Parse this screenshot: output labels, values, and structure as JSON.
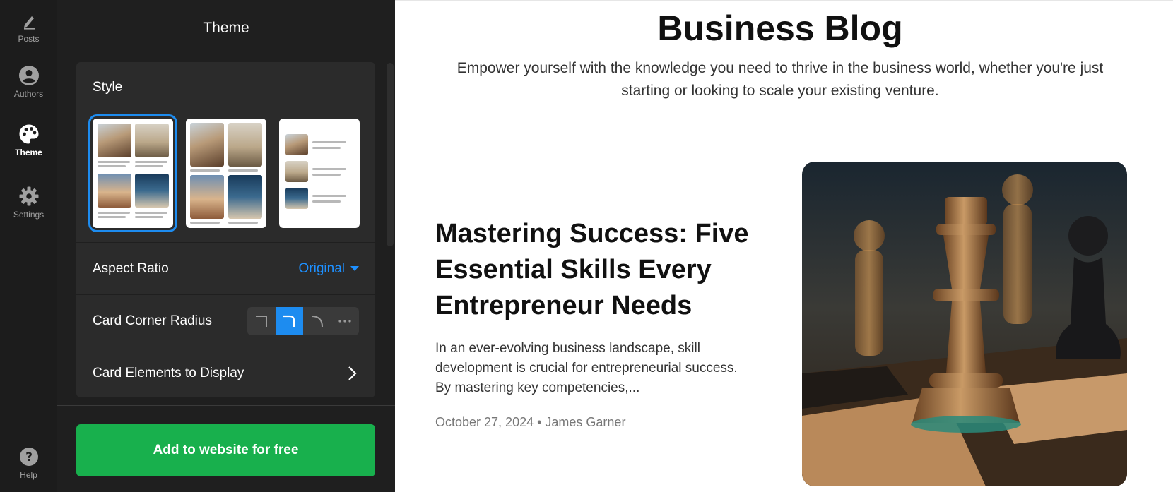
{
  "rail": {
    "items": [
      {
        "label": "Posts",
        "icon": "pencil-icon"
      },
      {
        "label": "Authors",
        "icon": "user-circle-icon"
      },
      {
        "label": "Theme",
        "icon": "palette-icon",
        "active": true
      },
      {
        "label": "Settings",
        "icon": "gear-icon"
      },
      {
        "label": "Help",
        "icon": "help-icon"
      }
    ]
  },
  "panel": {
    "title": "Theme",
    "style_label": "Style",
    "style_options": [
      "grid-large",
      "grid-small",
      "list"
    ],
    "selected_style": "grid-large",
    "aspect_ratio_label": "Aspect Ratio",
    "aspect_ratio_value": "Original",
    "corner_radius_label": "Card Corner Radius",
    "corner_radius_options": [
      "square",
      "rounded",
      "round",
      "more"
    ],
    "corner_radius_selected": "rounded",
    "card_elements_label": "Card Elements to Display",
    "cta_label": "Add to website for free"
  },
  "blog": {
    "title": "Business Blog",
    "subtitle": "Empower yourself with the knowledge you need to thrive in the business world, whether you're just starting or looking to scale your existing venture.",
    "post": {
      "title": "Mastering Success: Five Essential Skills Every Entrepreneur Needs",
      "excerpt": "In an ever-evolving business landscape, skill development is crucial for entrepreneurial success. By mastering key competencies,...",
      "meta": "October 27, 2024 • James Garner"
    }
  },
  "colors": {
    "accent": "#1d8cf0",
    "cta": "#18b04d",
    "panel_bg": "#1f1f1f",
    "card_bg": "#2b2b2b"
  }
}
